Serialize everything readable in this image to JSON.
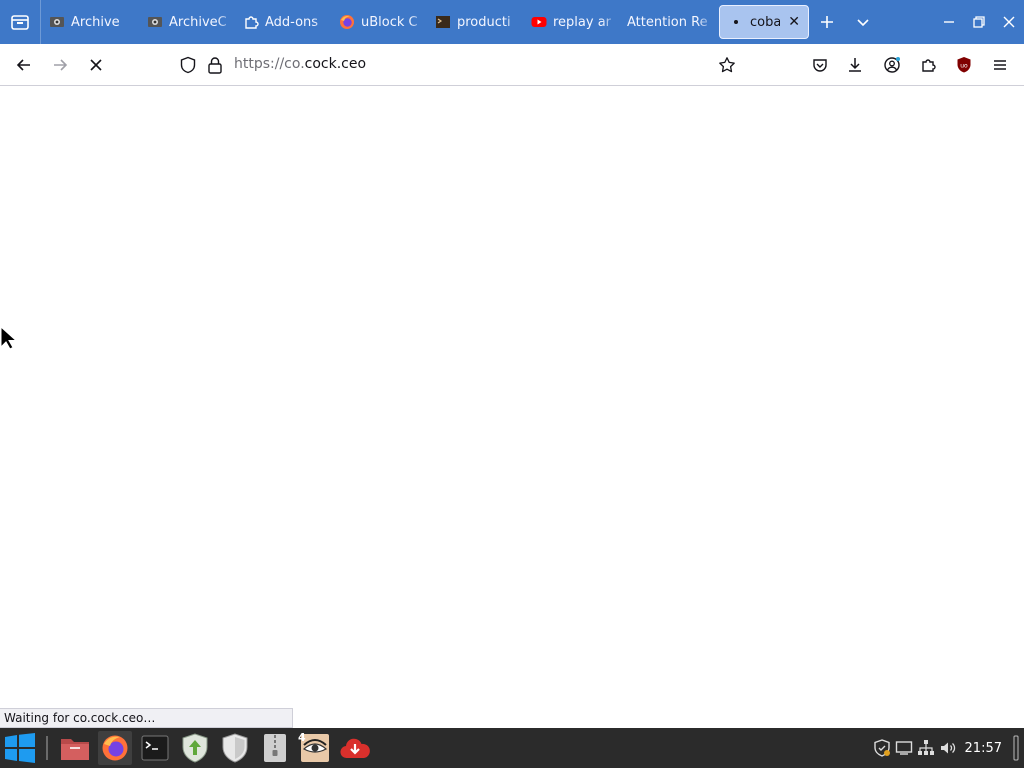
{
  "tabs": [
    {
      "title": "Archive",
      "icon": "archive-site-icon"
    },
    {
      "title": "ArchiveC",
      "icon": "archive-site-icon"
    },
    {
      "title": "Add-ons",
      "icon": "puzzle-icon"
    },
    {
      "title": "uBlock C",
      "icon": "firefox-icon"
    },
    {
      "title": "producti",
      "icon": "terminal-icon"
    },
    {
      "title": "replay ar",
      "icon": "youtube-icon"
    },
    {
      "title": "Attention Re",
      "icon": ""
    },
    {
      "title": "cobalt",
      "icon": "dot-icon",
      "active": true
    }
  ],
  "navbar": {
    "url_scheme": "https://co.",
    "url_host": "cock.ceo"
  },
  "status": {
    "text": "Waiting for co.cock.ceo…"
  },
  "taskbar": {
    "badge_count": "4",
    "clock": "21:57"
  },
  "colors": {
    "tabstrip": "#3e78c8",
    "active_tab": "#a9c4ef",
    "taskbar": "#2b2b2b",
    "ublock_red": "#800000"
  }
}
